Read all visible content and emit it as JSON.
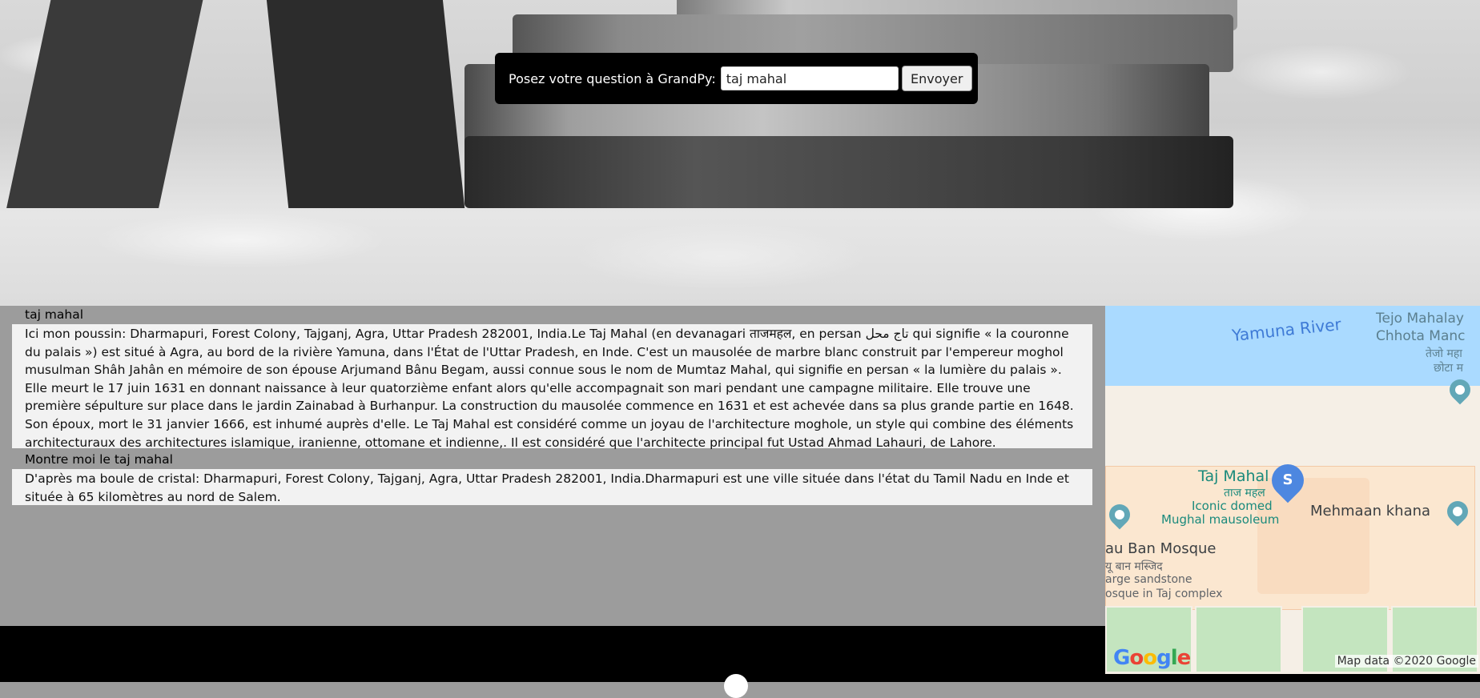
{
  "form": {
    "label": "Posez votre question à GrandPy:",
    "input_value": "taj mahal",
    "submit_label": "Envoyer"
  },
  "conversation": [
    {
      "question": "taj mahal",
      "answer": "Ici mon poussin: Dharmapuri, Forest Colony, Tajganj, Agra, Uttar Pradesh 282001, India.Le Taj Mahal (en devanagari ताजमहल, en persan تاج محل qui signifie « la couronne du palais ») est situé à Agra, au bord de la rivière Yamuna, dans l'État de l'Uttar Pradesh, en Inde. C'est un mausolée de marbre blanc construit par l'empereur moghol musulman Shâh Jahân en mémoire de son épouse Arjumand Bânu Begam, aussi connue sous le nom de Mumtaz Mahal, qui signifie en persan « la lumière du palais ». Elle meurt le 17 juin 1631 en donnant naissance à leur quatorzième enfant alors qu'elle accompagnait son mari pendant une campagne militaire. Elle trouve une première sépulture sur place dans le jardin Zainabad à Burhanpur. La construction du mausolée commence en 1631 et est achevée dans sa plus grande partie en 1648. Son époux, mort le 31 janvier 1666, est inhumé auprès d'elle. Le Taj Mahal est considéré comme un joyau de l'architecture moghole, un style qui combine des éléments architecturaux des architectures islamique, iranienne, ottomane et indienne,. Il est considéré que l'architecte principal fut Ustad Ahmad Lahauri, de Lahore."
    },
    {
      "question": "Montre moi le taj mahal",
      "answer": "D'après ma boule de cristal: Dharmapuri, Forest Colony, Tajganj, Agra, Uttar Pradesh 282001, India.Dharmapuri est une ville située dans l'état du Tamil Nadu en Inde et située à 65 kilomètres au nord de Salem."
    }
  ],
  "map": {
    "river_label": "Yamuna River",
    "place_top_right_1": "Tejo Mahalay",
    "place_top_right_2": "Chhota Manc",
    "place_top_right_3": "तेजो महा",
    "place_top_right_4": "छोटा म",
    "marker_letter": "S",
    "taj_title": "Taj Mahal",
    "taj_hindi": "ताज महल",
    "taj_desc_1": "Iconic domed",
    "taj_desc_2": "Mughal mausoleum",
    "mehmaan": "Mehmaan khana",
    "mosque_1": "au Ban Mosque",
    "mosque_2": "यू बान मस्जिद",
    "mosque_3": "arge sandstone",
    "mosque_4": "osque in Taj complex",
    "attribution": "Map data ©2020 Google",
    "google_letters": [
      "G",
      "o",
      "o",
      "g",
      "l",
      "e"
    ],
    "google_colors": [
      "#4285f4",
      "#ea4335",
      "#fbbc05",
      "#4285f4",
      "#34a853",
      "#ea4335"
    ]
  }
}
